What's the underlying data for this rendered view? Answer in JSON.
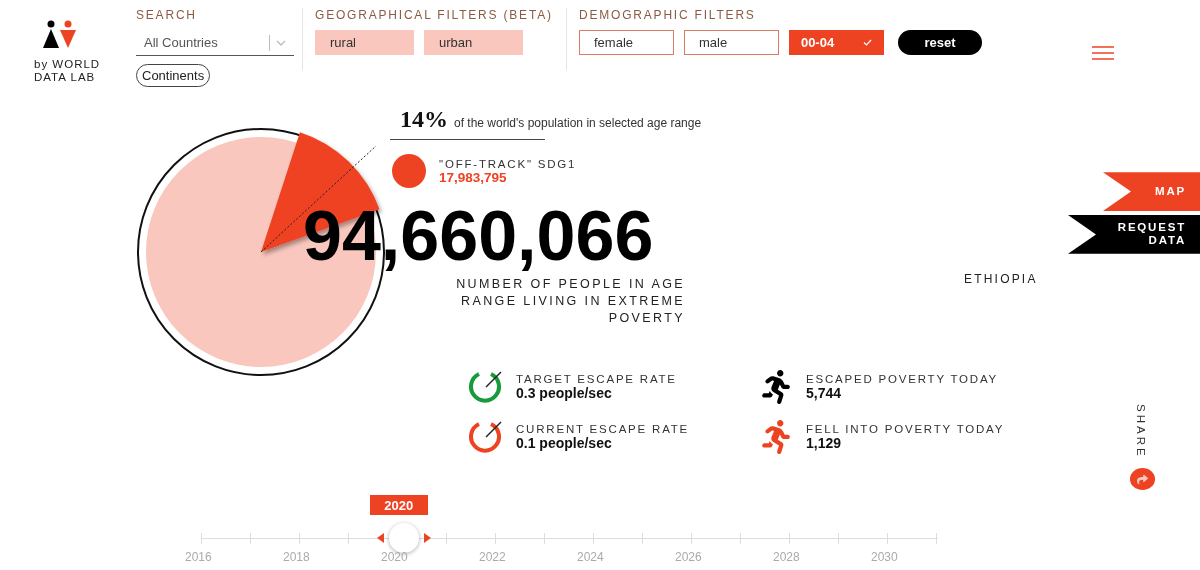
{
  "logo": {
    "text": "by WORLD DATA LAB"
  },
  "search": {
    "heading": "SEARCH",
    "value": "All Countries",
    "chip": "Continents"
  },
  "geo_filters": {
    "heading": "GEOGRAPHICAL FILTERS (BETA)",
    "options": [
      {
        "label": "rural",
        "selected": true
      },
      {
        "label": "urban",
        "selected": true
      }
    ]
  },
  "demographic_filters": {
    "heading": "DEMOGRAPHIC FILTERS",
    "genders": [
      {
        "label": "female",
        "selected": false
      },
      {
        "label": "male",
        "selected": false
      }
    ],
    "age_range": "00-04",
    "reset": "reset"
  },
  "share_of_world": {
    "value": "14%",
    "text": "of the world's population in selected age range"
  },
  "legend": {
    "label": "\"OFF-TRACK\" SDG1",
    "value": "17,983,795"
  },
  "total": {
    "value": "94,660,066",
    "caption": "NUMBER OF PEOPLE IN AGE RANGE LIVING IN EXTREME POVERTY"
  },
  "stats": [
    {
      "kind": "gauge",
      "color": "#179a3b",
      "label": "TARGET ESCAPE RATE",
      "value": "0.3 people/sec"
    },
    {
      "kind": "runner",
      "color": "#000000",
      "label": "ESCAPED POVERTY TODAY",
      "value": "5,744"
    },
    {
      "kind": "gauge",
      "color": "#ee4322",
      "label": "CURRENT ESCAPE RATE",
      "value": "0.1 people/sec"
    },
    {
      "kind": "runner",
      "color": "#ee4322",
      "label": "FELL INTO POVERTY TODAY",
      "value": "1,129"
    }
  ],
  "side_tabs": [
    {
      "label": "MAP",
      "color": "#ee4322"
    },
    {
      "label": "REQUEST DATA",
      "color": "#000000"
    }
  ],
  "country": "ETHIOPIA",
  "share": {
    "label": "SHARE"
  },
  "timeline": {
    "tooltip": "2020",
    "level": 0.275,
    "years": [
      "2016",
      "2018",
      "2020",
      "2022",
      "2024",
      "2026",
      "2028",
      "2030"
    ]
  }
}
